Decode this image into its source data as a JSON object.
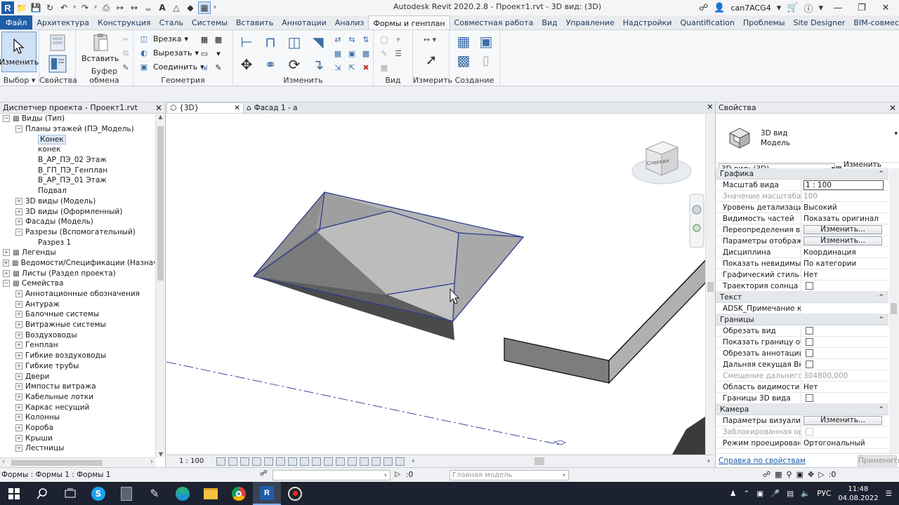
{
  "title_bar": {
    "window_title": "Autodesk Revit 2020.2.8 - Проект1.rvt - 3D вид: (3D)",
    "user": "can7ACG4",
    "icons": [
      "revit-logo-icon",
      "open-icon",
      "save-icon",
      "sync-icon",
      "undo-icon",
      "redo-icon",
      "print-icon",
      "measure-icon",
      "text-icon",
      "3d-view-icon",
      "switch-windows-icon"
    ]
  },
  "menu": {
    "tabs": [
      "Файл",
      "Архитектура",
      "Конструкция",
      "Сталь",
      "Системы",
      "Вставить",
      "Аннотации",
      "Анализ",
      "Формы и генплан",
      "Совместная работа",
      "Вид",
      "Управление",
      "Надстройки",
      "Quantification",
      "Проблемы",
      "Site Designer",
      "BIM-совместимость"
    ],
    "active": "Формы и генплан"
  },
  "ribbon": {
    "modify_label": "Изменить",
    "paste_label": "Вставить",
    "cut_label": "Врезка",
    "trim_label": "Вырезать",
    "join_label": "Соединить",
    "groups": {
      "select": "Выбор",
      "properties": "Свойства",
      "clipboard": "Буфер обмена",
      "geometry": "Геометрия",
      "modify": "Изменить",
      "view": "Вид",
      "measure": "Измерить",
      "create": "Создание"
    }
  },
  "project_browser": {
    "title": "Диспетчер проекта - Проект1.rvt",
    "items": [
      {
        "label": "Виды (Тип)",
        "level": 0,
        "exp": "−"
      },
      {
        "label": "Планы этажей (ПЭ_Модель)",
        "level": 1,
        "exp": "−"
      },
      {
        "label": "Конек",
        "level": 2,
        "exp": "",
        "selected": true
      },
      {
        "label": "конек",
        "level": 2,
        "exp": ""
      },
      {
        "label": "В_АР_ПЭ_02 Этаж",
        "level": 2,
        "exp": ""
      },
      {
        "label": "В_ГП_ПЭ_Генплан",
        "level": 2,
        "exp": ""
      },
      {
        "label": "В_АР_ПЭ_01 Этаж",
        "level": 2,
        "exp": ""
      },
      {
        "label": "Подвал",
        "level": 2,
        "exp": ""
      },
      {
        "label": "3D виды (Модель)",
        "level": 1,
        "exp": "+"
      },
      {
        "label": "3D виды (Оформленный)",
        "level": 1,
        "exp": "+"
      },
      {
        "label": "Фасады (Модель)",
        "level": 1,
        "exp": "+"
      },
      {
        "label": "Разрезы (Вспомогательный)",
        "level": 1,
        "exp": "−"
      },
      {
        "label": "Разрез 1",
        "level": 2,
        "exp": ""
      },
      {
        "label": "Легенды",
        "level": 0,
        "exp": "+"
      },
      {
        "label": "Ведомости/Спецификации (Назначение",
        "level": 0,
        "exp": "+"
      },
      {
        "label": "Листы (Раздел проекта)",
        "level": 0,
        "exp": "+"
      },
      {
        "label": "Семейства",
        "level": 0,
        "exp": "−"
      },
      {
        "label": "Аннотационные обозначения",
        "level": 1,
        "exp": "+"
      },
      {
        "label": "Антураж",
        "level": 1,
        "exp": "+"
      },
      {
        "label": "Балочные системы",
        "level": 1,
        "exp": "+"
      },
      {
        "label": "Витражные системы",
        "level": 1,
        "exp": "+"
      },
      {
        "label": "Воздуховоды",
        "level": 1,
        "exp": "+"
      },
      {
        "label": "Генплан",
        "level": 1,
        "exp": "+"
      },
      {
        "label": "Гибкие воздуховоды",
        "level": 1,
        "exp": "+"
      },
      {
        "label": "Гибкие трубы",
        "level": 1,
        "exp": "+"
      },
      {
        "label": "Двери",
        "level": 1,
        "exp": "+"
      },
      {
        "label": "Импосты витража",
        "level": 1,
        "exp": "+"
      },
      {
        "label": "Кабельные лотки",
        "level": 1,
        "exp": "+"
      },
      {
        "label": "Каркас несущий",
        "level": 1,
        "exp": "+"
      },
      {
        "label": "Колонны",
        "level": 1,
        "exp": "+"
      },
      {
        "label": "Короба",
        "level": 1,
        "exp": "+"
      },
      {
        "label": "Крыши",
        "level": 1,
        "exp": "+"
      },
      {
        "label": "Лестницы",
        "level": 1,
        "exp": "+"
      }
    ]
  },
  "view_tabs": [
    {
      "label": "{3D}",
      "active": true
    },
    {
      "label": "Фасад 1 - а",
      "active": false
    }
  ],
  "viewcube_label": "Спереди",
  "view_bar": {
    "scale": "1 : 100"
  },
  "properties": {
    "title": "Свойства",
    "type_name": "3D вид",
    "type_sub": "Модель",
    "selector": "3D вид: (3D)",
    "edit_type": "Изменить тип",
    "sections": [
      {
        "name": "Графика",
        "rows": [
          {
            "k": "Масштаб вида",
            "v": "1 : 100",
            "kind": "input"
          },
          {
            "k": "Значение масштаба",
            "v": "100",
            "kind": "text",
            "disabled": true
          },
          {
            "k": "Уровень детализации",
            "v": "Высокий",
            "kind": "text"
          },
          {
            "k": "Видимость частей",
            "v": "Показать оригинал",
            "kind": "text"
          },
          {
            "k": "Переопределения ви...",
            "v": "Изменить...",
            "kind": "button"
          },
          {
            "k": "Параметры отображе...",
            "v": "Изменить...",
            "kind": "button"
          },
          {
            "k": "Дисциплина",
            "v": "Координация",
            "kind": "text"
          },
          {
            "k": "Показать невидимые ...",
            "v": "По категории",
            "kind": "text"
          },
          {
            "k": "Графический стиль от...",
            "v": "Нет",
            "kind": "text"
          },
          {
            "k": "Траектория солнца",
            "v": "",
            "kind": "check"
          }
        ]
      },
      {
        "name": "Текст",
        "rows": [
          {
            "k": "ADSK_Примечание к ...",
            "v": "",
            "kind": "text"
          }
        ]
      },
      {
        "name": "Границы",
        "rows": [
          {
            "k": "Обрезать вид",
            "v": "",
            "kind": "check"
          },
          {
            "k": "Показать границу об...",
            "v": "",
            "kind": "check"
          },
          {
            "k": "Обрезать аннотации",
            "v": "",
            "kind": "check"
          },
          {
            "k": "Дальняя секущая Вкл",
            "v": "",
            "kind": "check"
          },
          {
            "k": "Смещение дальнего ...",
            "v": "304800,000",
            "kind": "text",
            "disabled": true
          },
          {
            "k": "Область видимости",
            "v": "Нет",
            "kind": "text"
          },
          {
            "k": "Границы 3D вида",
            "v": "",
            "kind": "check"
          }
        ]
      },
      {
        "name": "Камера",
        "rows": [
          {
            "k": "Параметры визуализ...",
            "v": "Изменить...",
            "kind": "button"
          },
          {
            "k": "Заблокированная ор...",
            "v": "",
            "kind": "check",
            "disabled": true
          },
          {
            "k": "Режим проецирования",
            "v": "Ортогональный",
            "kind": "text"
          }
        ]
      }
    ],
    "help_link": "Справка по свойствам",
    "apply": "Применить"
  },
  "status_bar": {
    "text": "Формы : Формы 1 : Формы 1",
    "filter_count": ":0",
    "model": "Главная модель",
    "select_count": ":0"
  },
  "taskbar": {
    "lang": "РУС",
    "time": "11:48",
    "date": "04.08.2022"
  },
  "colors": {
    "accent": "#1f5da8",
    "shape_face": "#a9a9a9",
    "shape_edge": "#2b3a8c"
  }
}
